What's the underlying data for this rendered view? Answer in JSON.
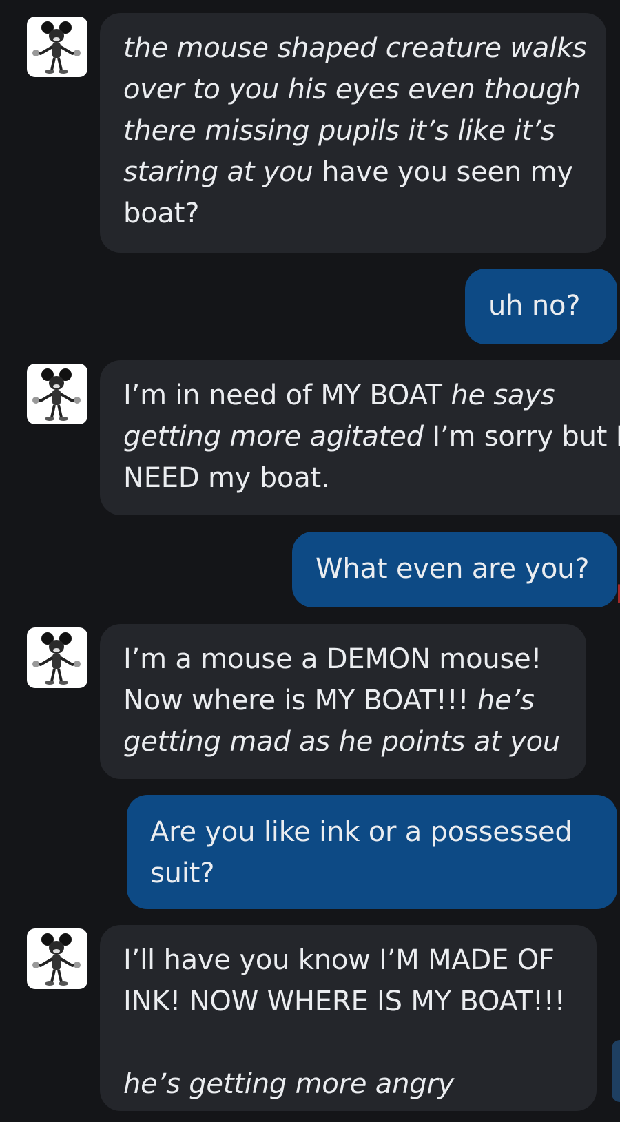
{
  "messages": [
    {
      "sender": "bot",
      "segments": [
        {
          "text": "the mouse shaped creature walks",
          "italic": true
        },
        {
          "text": "over to you his eyes even though",
          "italic": true
        },
        {
          "text": "there missing pupils it’s like it’s",
          "italic": true
        },
        {
          "text": "staring at you",
          "italic": true
        },
        {
          "text": " have you seen my",
          "italic": false
        },
        {
          "text": "boat?",
          "italic": false
        }
      ]
    },
    {
      "sender": "user",
      "text": "uh no?"
    },
    {
      "sender": "bot",
      "segments": [
        {
          "text": "I’m in need of MY BOAT ",
          "italic": false
        },
        {
          "text": "he says",
          "italic": true
        },
        {
          "text": "getting more agitated",
          "italic": true
        },
        {
          "text": " I’m sorry but I",
          "italic": false
        },
        {
          "text": "NEED my boat.",
          "italic": false
        }
      ]
    },
    {
      "sender": "user",
      "text": "What even are you?"
    },
    {
      "sender": "bot",
      "segments": [
        {
          "text": "I’m a mouse a DEMON mouse!",
          "italic": false
        },
        {
          "text": "Now where is MY BOAT!!! ",
          "italic": false
        },
        {
          "text": "he’s",
          "italic": true
        },
        {
          "text": "getting mad as he points at you",
          "italic": true
        }
      ]
    },
    {
      "sender": "user",
      "line1": "Are you like ink or a possessed",
      "line2": "suit?"
    },
    {
      "sender": "bot",
      "segments": [
        {
          "text": "I’ll have you know I’M MADE OF",
          "italic": false
        },
        {
          "text": "INK! NOW WHERE IS MY BOAT!!!",
          "italic": false
        },
        {
          "text": "he’s getting more angry",
          "italic": true
        }
      ]
    }
  ],
  "icons": {
    "avatar": "mouse-character-avatar-icon"
  },
  "colors": {
    "background": "#141518",
    "bot_bubble": "#24262b",
    "user_bubble": "#0d4a85",
    "text": "#ebedf0"
  }
}
